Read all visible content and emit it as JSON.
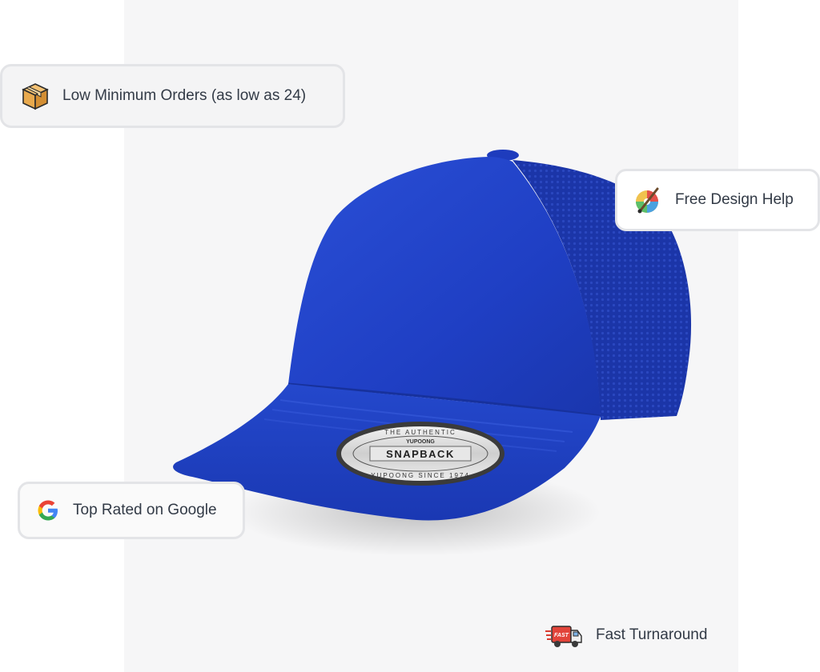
{
  "features": {
    "orders_label": "Low Minimum Orders (as low as 24)",
    "design_label": "Free Design Help",
    "google_label": "Top Rated on Google",
    "turnaround_label": "Fast Turnaround"
  },
  "product": {
    "color": "#1f3fc4",
    "patch_top_text": "THE AUTHENTIC",
    "patch_brand_text": "YUPOONG",
    "patch_main_text": "SNAPBACK",
    "patch_bottom_text": "YUPOONG SINCE 1974"
  },
  "icons": {
    "orders": "package-box-icon",
    "design": "paint-palette-icon",
    "google": "google-g-icon",
    "turnaround": "delivery-truck-icon"
  },
  "truck_text": "FAST"
}
